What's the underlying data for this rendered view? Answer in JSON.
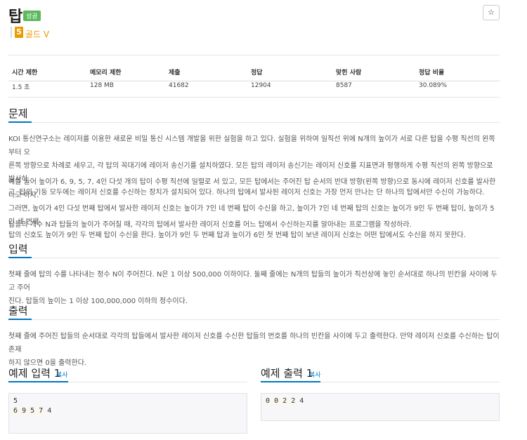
{
  "problem": {
    "title": "탑",
    "status_badge": "성공",
    "star_icon": "☆",
    "tier": {
      "number": "5",
      "label": "골드 V",
      "color": "#ec9a00"
    }
  },
  "stats": {
    "headers": [
      "시간 제한",
      "메모리 제한",
      "제출",
      "정답",
      "맞힌 사람",
      "정답 비율"
    ],
    "values": [
      "1.5 초",
      "128 MB",
      "41682",
      "12904",
      "8587",
      "30.089%"
    ]
  },
  "sections": {
    "problem_title": "문제",
    "problem_paragraphs": [
      [
        "KOI 통신연구소는 레이저를 이용한 새로운 비밀 통신 시스템 개발을 위한 실험을 하고 있다. 실험을 위하여 일직선 위에 N개의 높이가 서로 다른 탑을 수평 직선의 왼쪽부터 오",
        "른쪽 방향으로 차례로 세우고, 각 탑의 꼭대기에 레이저 송신기를 설치하였다. 모든 탑의 레이저 송신기는 레이저 신호를 지표면과 평행하게 수평 직선의 왼쪽 방향으로 발사하",
        "고, 탑의 기둥 모두에는 레이저 신호를 수신하는 장치가 설치되어 있다. 하나의 탑에서 발사된 레이저 신호는 가장 먼저 만나는 단 하나의 탑에서만 수신이 가능하다."
      ],
      [
        "예를 들어 높이가 6, 9, 5, 7, 4인 다섯 개의 탑이 수평 직선에 일렬로 서 있고, 모든 탑에서는 주어진 탑 순서의 반대 방향(왼쪽 방향)으로 동시에 레이저 신호를 발사한다고 하자.",
        "그러면, 높이가 4인 다섯 번째 탑에서 발사한 레이저 신호는 높이가 7인 네 번째 탑이 수신을 하고, 높이가 7인 네 번째 탑의 신호는 높이가 9인 두 번째 탑이, 높이가 5인 세 번째",
        "탑의 신호도 높이가 9인 두 번째 탑이 수신을 한다. 높이가 9인 두 번째 탑과 높이가 6인 첫 번째 탑이 보낸 레이저 신호는 어떤 탑에서도 수신을 하지 못한다."
      ],
      [
        "탑들의 개수 N과 탑들의 높이가 주어질 때, 각각의 탑에서 발사한 레이저 신호를 어느 탑에서 수신하는지를 알아내는 프로그램을 작성하라."
      ]
    ],
    "input_title": "입력",
    "input_lines": [
      "첫째 줄에 탑의 수를 나타내는 정수 N이 주어진다. N은 1 이상 500,000 이하이다. 둘째 줄에는 N개의 탑들의 높이가 직선상에 놓인 순서대로 하나의 빈칸을 사이에 두고 주어",
      "진다. 탑들의 높이는 1 이상 100,000,000 이하의 정수이다."
    ],
    "output_title": "출력",
    "output_lines": [
      "첫째 줄에 주어진 탑들의 순서대로 각각의 탑들에서 발사한 레이저 신호를 수신한 탑들의 번호를 하나의 빈칸을 사이에 두고 출력한다. 만약 레이저 신호를 수신하는 탑이 존재",
      "하지 않으면 0을 출력한다."
    ]
  },
  "examples": {
    "input_title": "예제 입력 1",
    "output_title": "예제 출력 1",
    "copy_label": "복사",
    "input_line1": "5",
    "input_line2_tokens": [
      "6",
      "9",
      "5",
      "7",
      "4"
    ],
    "output_tokens": [
      "0",
      "0",
      "2",
      "2",
      "4"
    ]
  },
  "colors": {
    "accent": "#0076c0",
    "success": "#5cb85c",
    "gold": "#ec9a00"
  }
}
